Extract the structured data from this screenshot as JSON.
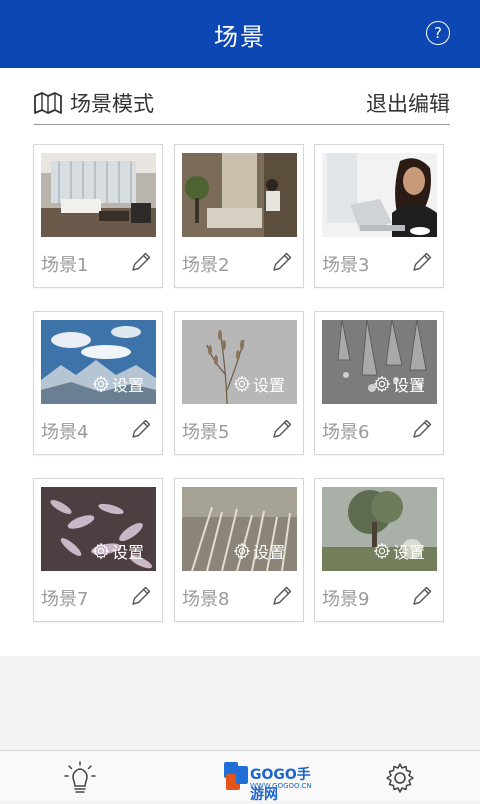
{
  "header": {
    "title": "场景",
    "help_icon": "?"
  },
  "section": {
    "title": "场景模式",
    "exit_label": "退出编辑"
  },
  "scenes": [
    {
      "label": "场景1",
      "setting": ""
    },
    {
      "label": "场景2",
      "setting": ""
    },
    {
      "label": "场景3",
      "setting": ""
    },
    {
      "label": "场景4",
      "setting": "设置"
    },
    {
      "label": "场景5",
      "setting": "设置"
    },
    {
      "label": "场景6",
      "setting": "设置"
    },
    {
      "label": "场景7",
      "setting": "设置"
    },
    {
      "label": "场景8",
      "setting": "设置"
    },
    {
      "label": "场景9",
      "setting": "设置"
    }
  ],
  "bottom_nav": [
    {
      "icon": "lightbulb-icon"
    },
    {
      "icon": "scene-icon",
      "brand": "GOGO手游网",
      "brand_url": "WWW.GOGOO.CN"
    },
    {
      "icon": "gear-icon"
    }
  ],
  "colors": {
    "header": "#0c47b3",
    "text_gray": "#9a9a9a"
  }
}
